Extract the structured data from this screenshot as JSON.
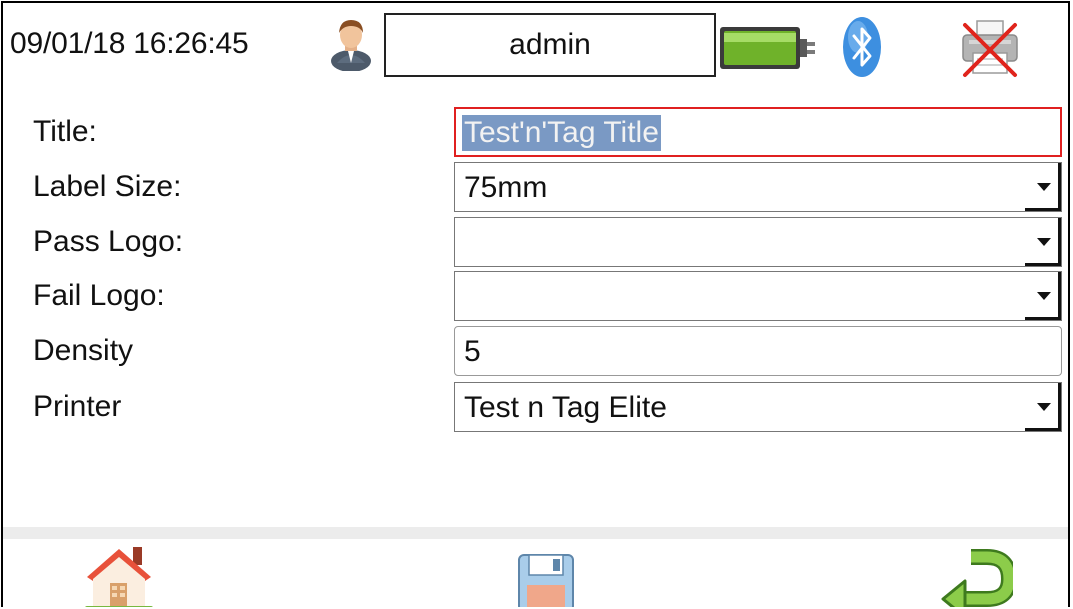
{
  "status_bar": {
    "datetime": "09/01/18 16:26:45",
    "user": "admin",
    "icons": {
      "user": "user-avatar-icon",
      "battery": "battery-full-icon",
      "bluetooth": "bluetooth-icon",
      "printer": "printer-disconnected-icon"
    },
    "battery_level": 1.0
  },
  "form": {
    "title": {
      "label": "Title:",
      "value": "Test'n'Tag Title"
    },
    "label_size": {
      "label": "Label Size:",
      "value": "75mm"
    },
    "pass_logo": {
      "label": "Pass Logo:",
      "value": ""
    },
    "fail_logo": {
      "label": "Fail Logo:",
      "value": ""
    },
    "density": {
      "label": "Density",
      "value": "5"
    },
    "printer": {
      "label": "Printer",
      "value": "Test n Tag Elite"
    }
  },
  "bottom_bar": {
    "icons": {
      "home": "home-icon",
      "save": "save-icon",
      "back": "back-arrow-icon"
    }
  },
  "colors": {
    "focus_border": "#e02020",
    "selection_highlight": "#7a99c4",
    "battery_fill": "#6fb22a",
    "bluetooth": "#3d8fe0",
    "back_arrow": "#7dc242",
    "home_roof": "#e8513a"
  }
}
